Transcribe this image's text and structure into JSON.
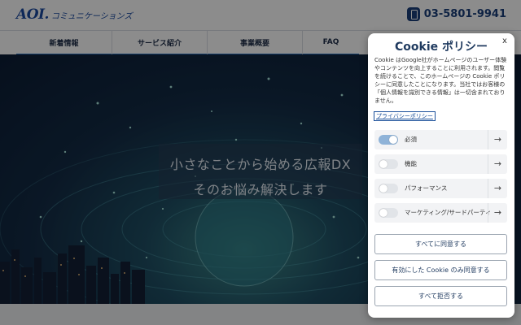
{
  "site": {
    "logo_main": "AOI.",
    "logo_sub": "コミュニケーションズ",
    "phone": "03-5801-9941",
    "nav": [
      {
        "label": "新着情報"
      },
      {
        "label": "サービス紹介"
      },
      {
        "label": "事業概要"
      },
      {
        "label": "FAQ"
      }
    ],
    "hero_line1": "小さなことから始める広報DX",
    "hero_line2": "そのお悩み解決します"
  },
  "cookie": {
    "title": "Cookie ポリシー",
    "close": "x",
    "description": "Cookie はGoogle社がホームページのユーザー体験やコンテンツを向上することに利用されます。閲覧を続けることで、このホームページの Cookie ポリシーに同意したことになります。当社ではお客様の「個人情報を識別できる情報」は一切含まれておりません。",
    "privacy_link": "プライバシーポリシー",
    "categories": [
      {
        "label": "必須",
        "enabled": true
      },
      {
        "label": "機能",
        "enabled": false
      },
      {
        "label": "パフォーマンス",
        "enabled": false
      },
      {
        "label": "マーケティング/サードパーティ",
        "enabled": false
      }
    ],
    "arrow": "→",
    "buttons": {
      "accept_all": "すべてに同意する",
      "accept_enabled": "有効にした Cookie のみ同意する",
      "reject_all": "すべて拒否する"
    }
  },
  "colors": {
    "brand": "#1b4aa0",
    "title": "#1f3a5f",
    "toggle_on": "#8fb3d8"
  }
}
